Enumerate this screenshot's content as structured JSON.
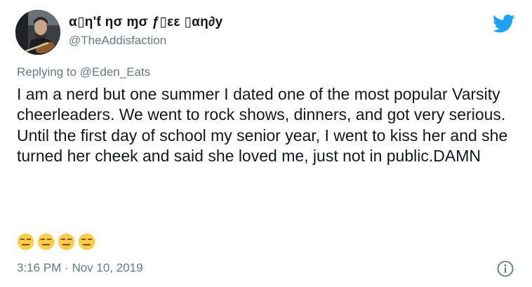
{
  "author": {
    "display_name": "α\u0001\u0001η'ƭ ησ ɱσ ƒ\u0001εε \u0001αη∂у",
    "display_name_text": "α▯η'ƭ ησ ɱσ ƒ▯εε ▯αη∂у",
    "handle": "@TheAddisfaction"
  },
  "reply": {
    "prefix": "Replying to",
    "target": "@Eden_Eats"
  },
  "body": {
    "paragraph1": "I am a nerd but one summer I dated one of the most popular Varsity cheerleaders. We went to rock shows, dinners, and got very serious.",
    "paragraph2": "Until the first day of school my senior year, I went to kiss her and she turned her cheek and said she loved me, just not in public.DAMN"
  },
  "emoji_count": 4,
  "emoji_name": "expressionless-face",
  "timestamp": {
    "time": "3:16 PM",
    "separator": "·",
    "date": "Nov 10, 2019"
  },
  "colors": {
    "twitter_blue": "#1da1f2",
    "text_primary": "#14171a",
    "text_secondary": "#657786",
    "emoji_yellow": "#ffcc4d"
  },
  "icons": {
    "brand": "twitter-bird-icon",
    "info": "info-icon"
  }
}
